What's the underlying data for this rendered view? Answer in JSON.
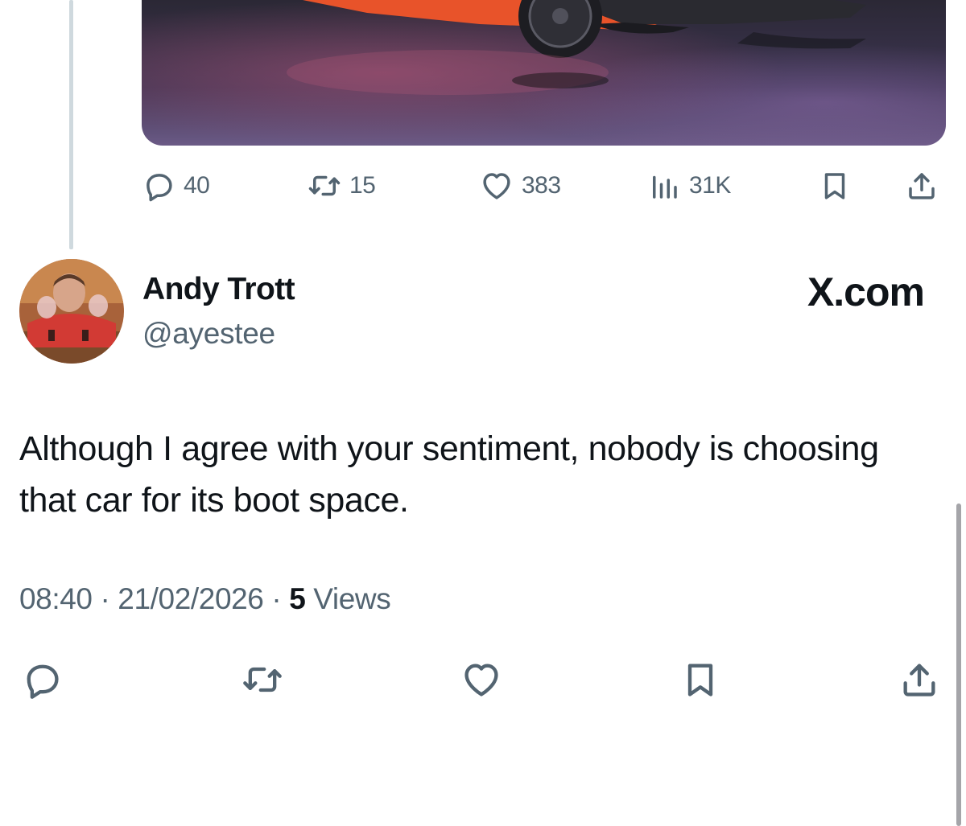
{
  "quoted_tweet": {
    "image_alt": "orange sports car on dark reflective floor",
    "actions": {
      "reply_count": "40",
      "repost_count": "15",
      "like_count": "383",
      "views_count": "31K"
    },
    "icons": [
      "reply-icon",
      "repost-icon",
      "like-icon",
      "analytics-icon",
      "bookmark-icon",
      "share-icon"
    ]
  },
  "tweet": {
    "author_name": "Andy Trott",
    "author_handle": "@ayestee",
    "text": "Although I agree with your sentiment, nobody is choosing that car for its boot space.",
    "time": "08:40",
    "date": "21/02/2026",
    "separator": "·",
    "views_count": "5",
    "views_label": "Views"
  },
  "brand": "X.com",
  "colors": {
    "text_primary": "#0f1419",
    "text_secondary": "#536471",
    "thread_line": "#cfd9de",
    "car": "#e8532a"
  }
}
